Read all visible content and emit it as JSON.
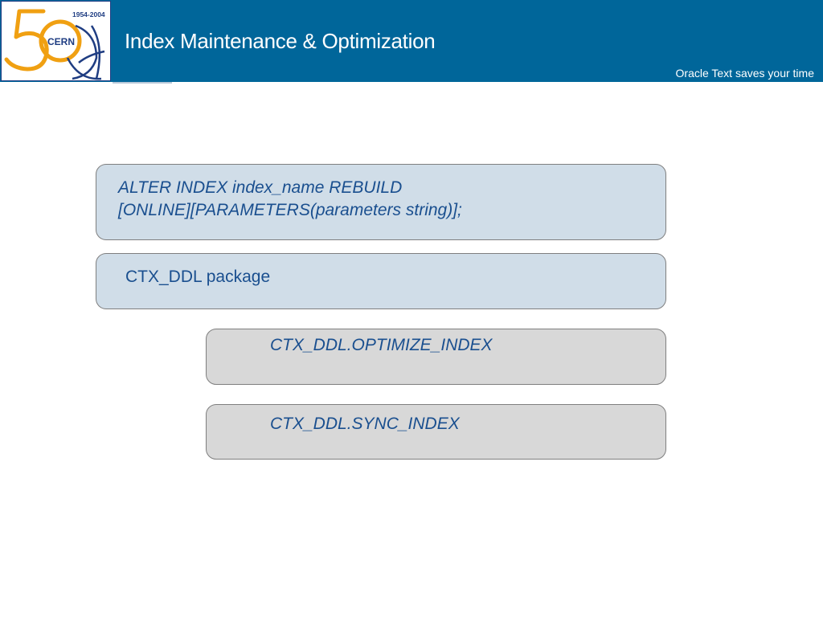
{
  "header": {
    "title": "Index Maintenance & Optimization",
    "tagline": "Oracle Text saves your time",
    "logo": {
      "years": "1954-2004",
      "name": "CERN",
      "anniversary": "50"
    }
  },
  "boxes": {
    "alter_index": {
      "line1": "ALTER INDEX index_name REBUILD",
      "line2": "[ONLINE][PARAMETERS(parameters string)];"
    },
    "ctx_ddl": {
      "label": "CTX_DDL package"
    },
    "optimize": {
      "label": "CTX_DDL.OPTIMIZE_INDEX"
    },
    "sync": {
      "label": "CTX_DDL.SYNC_INDEX"
    }
  },
  "colors": {
    "header_bg": "#00669a",
    "box_blue": "#d0dde8",
    "box_gray": "#d8d8d8",
    "text_blue": "#1a4f8f",
    "logo_orange": "#f0a012",
    "logo_navy": "#1f3d82"
  }
}
